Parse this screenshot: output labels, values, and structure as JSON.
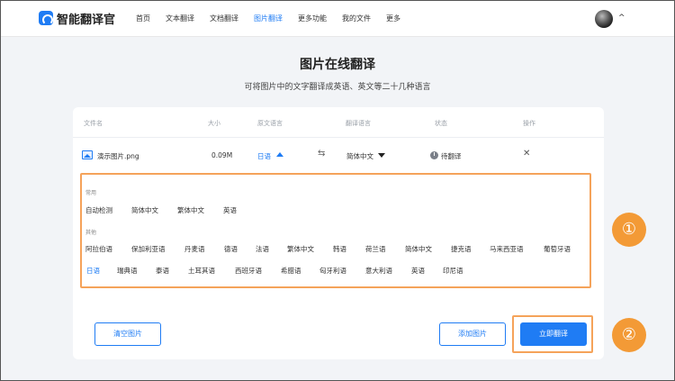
{
  "app": {
    "brand": "智能翻译官"
  },
  "nav": {
    "items": [
      {
        "label": "首页"
      },
      {
        "label": "文本翻译"
      },
      {
        "label": "文档翻译"
      },
      {
        "label": "图片翻译",
        "active": true
      },
      {
        "label": "更多功能"
      },
      {
        "label": "我的文件"
      },
      {
        "label": "更多"
      }
    ],
    "chevron": "^"
  },
  "page": {
    "title": "图片在线翻译",
    "subtitle": "可将图片中的文字翻译成英语、英文等二十几种语言"
  },
  "table": {
    "headers": {
      "filename": "文件名",
      "size": "大小",
      "source": "原文语言",
      "target": "翻译语言",
      "status": "状态",
      "action": "操作"
    },
    "row": {
      "filename": "演示图片.png",
      "size": "0.09M",
      "source": "日语",
      "target": "简体中文",
      "status": "待翻译",
      "action_icon": "close-icon"
    }
  },
  "languages": {
    "common_label": "常用",
    "common": [
      "自动检测",
      "简体中文",
      "繁体中文",
      "英语"
    ],
    "other_label": "其他",
    "other_row1": [
      "阿拉伯语",
      "保加利亚语",
      "丹麦语",
      "德语",
      "法语",
      "繁体中文",
      "韩语",
      "荷兰语",
      "简体中文",
      "捷克语",
      "马来西亚语",
      "葡萄牙语"
    ],
    "other_row2": [
      "日语",
      "瑞典语",
      "泰语",
      "土耳其语",
      "西班牙语",
      "希腊语",
      "匈牙利语",
      "意大利语",
      "英语",
      "印尼语"
    ],
    "selected": "日语"
  },
  "buttons": {
    "clear": "清空图片",
    "add": "添加图片",
    "translate": "立即翻译"
  },
  "annotations": {
    "badge1": "①",
    "badge2": "②"
  },
  "colors": {
    "accent": "#1f7cf4",
    "highlight": "#f5a35a",
    "badge": "#f39a36"
  }
}
